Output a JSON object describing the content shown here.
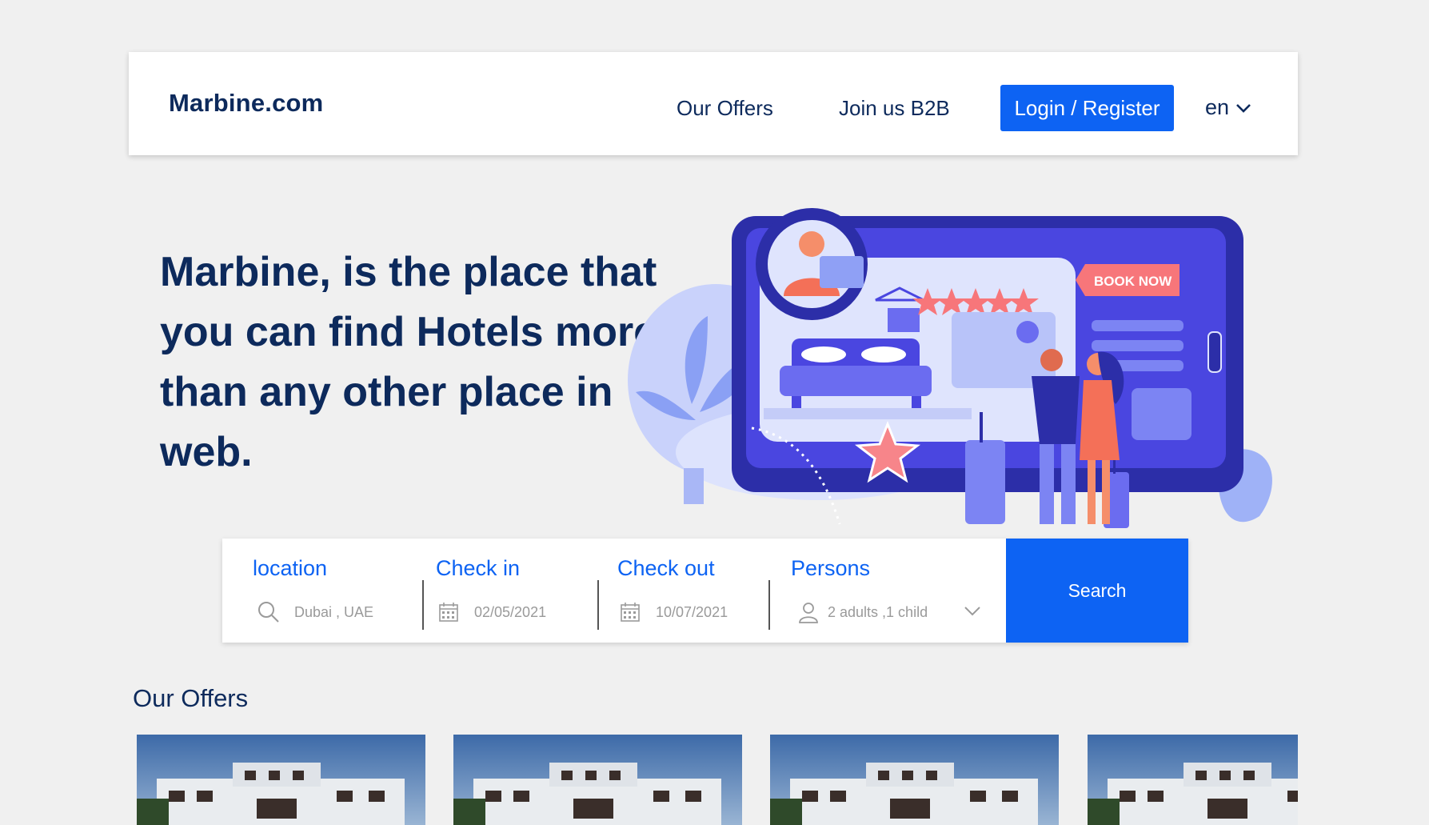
{
  "header": {
    "logo": "Marbine.com",
    "nav": {
      "offers": "Our Offers",
      "b2b": "Join us B2B"
    },
    "login_label": "Login / Register",
    "language": "en"
  },
  "hero": {
    "title": "Marbine, is the place that you can find Hotels more than any other place in web.",
    "illustration_text": {
      "book_now": "BOOK NOW"
    }
  },
  "search": {
    "location": {
      "label": "location",
      "value": "Dubai , UAE",
      "icon": "search-icon"
    },
    "check_in": {
      "label": "Check in",
      "value": "02/05/2021",
      "icon": "calendar-icon"
    },
    "check_out": {
      "label": "Check out",
      "value": "10/07/2021",
      "icon": "calendar-icon"
    },
    "persons": {
      "label": "Persons",
      "value": "2 adults ,1 child",
      "icon": "user-icon"
    },
    "button_label": "Search"
  },
  "offers": {
    "title": "Our Offers",
    "cards_count_visible": 4
  },
  "colors": {
    "primary": "#0d63f3",
    "text_dark": "#0d2a5c",
    "background": "#f0f0f0"
  }
}
